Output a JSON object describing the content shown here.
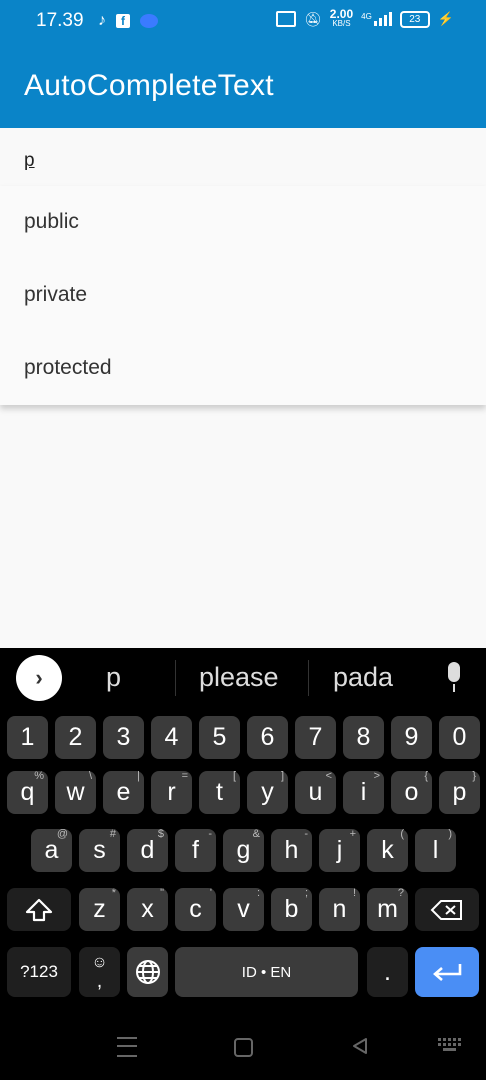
{
  "status": {
    "time": "17.39",
    "net_speed": "2.00",
    "net_unit": "KB/S",
    "net_type": "4G",
    "battery": "23"
  },
  "appbar": {
    "title": "AutoCompleteText"
  },
  "input": {
    "value": "p"
  },
  "suggestions_list": [
    "public",
    "private",
    "protected"
  ],
  "keyboard": {
    "suggestions": [
      "p",
      "please",
      "pada"
    ],
    "numbers": [
      "1",
      "2",
      "3",
      "4",
      "5",
      "6",
      "7",
      "8",
      "9",
      "0"
    ],
    "row1": [
      [
        "q",
        "%"
      ],
      [
        "w",
        "\\"
      ],
      [
        "e",
        "|"
      ],
      [
        "r",
        "="
      ],
      [
        "t",
        "["
      ],
      [
        "y",
        "]"
      ],
      [
        "u",
        "<"
      ],
      [
        "i",
        ">"
      ],
      [
        "o",
        "{"
      ],
      [
        "p",
        "}"
      ]
    ],
    "row2": [
      [
        "a",
        "@"
      ],
      [
        "s",
        "#"
      ],
      [
        "d",
        "$"
      ],
      [
        "f",
        "-"
      ],
      [
        "g",
        "&"
      ],
      [
        "h",
        "-"
      ],
      [
        "j",
        "+"
      ],
      [
        "k",
        "("
      ],
      [
        "l",
        ")"
      ]
    ],
    "row3": [
      [
        "z",
        "*"
      ],
      [
        "x",
        "\""
      ],
      [
        "c",
        "'"
      ],
      [
        "v",
        ":"
      ],
      [
        "b",
        ";"
      ],
      [
        "n",
        "!"
      ],
      [
        "m",
        "?"
      ]
    ],
    "symbols_label": "?123",
    "comma_label": ",",
    "space_label": "ID • EN",
    "period_label": "."
  }
}
